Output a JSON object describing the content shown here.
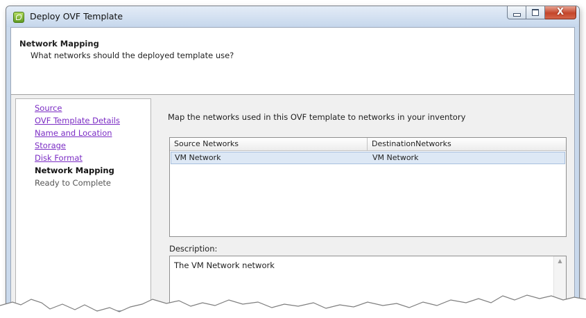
{
  "window": {
    "title": "Deploy OVF Template",
    "close_glyph": "X"
  },
  "header": {
    "title": "Network Mapping",
    "subtitle": "What networks should the deployed template use?"
  },
  "steps": [
    {
      "label": "Source",
      "state": "completed"
    },
    {
      "label": "OVF Template Details",
      "state": "completed"
    },
    {
      "label": "Name and Location",
      "state": "completed"
    },
    {
      "label": "Storage",
      "state": "completed"
    },
    {
      "label": "Disk Format",
      "state": "completed"
    },
    {
      "label": "Network Mapping",
      "state": "current"
    },
    {
      "label": "Ready to Complete",
      "state": "pending"
    }
  ],
  "main": {
    "intro": "Map the networks used in this OVF template to networks in your inventory",
    "table": {
      "columns": [
        "Source Networks",
        "DestinationNetworks"
      ],
      "rows": [
        {
          "source": "VM Network",
          "destination": "VM Network"
        }
      ]
    },
    "description_label": "Description:",
    "description_text": "The VM Network network"
  },
  "colors": {
    "link": "#7b2cc4",
    "selected_row": "#dde8f5",
    "title_bar": "#c6d7ec"
  }
}
